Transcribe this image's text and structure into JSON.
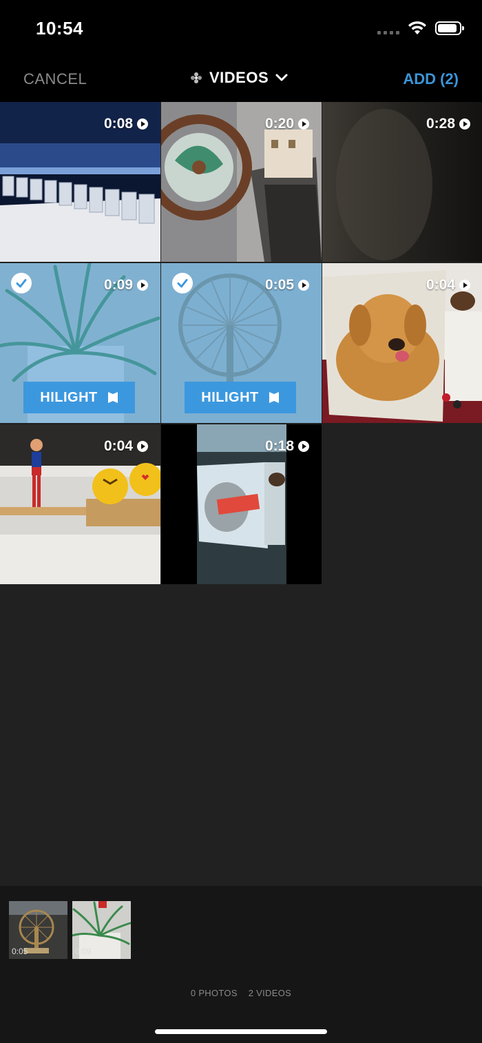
{
  "status_bar": {
    "time": "10:54",
    "battery_level": 0.9
  },
  "nav": {
    "cancel_label": "CANCEL",
    "title": "VIDEOS",
    "add_label": "ADD (2)",
    "accent_color": "#3b95d9"
  },
  "grid": {
    "tiles": [
      {
        "duration": "0:08",
        "selected": false,
        "scene": "shot glasses on bar counter"
      },
      {
        "duration": "0:20",
        "selected": false,
        "scene": "ship wheel souvenir magnet"
      },
      {
        "duration": "0:28",
        "selected": false,
        "scene": "dark blurred frame"
      },
      {
        "duration": "0:09",
        "selected": true,
        "scene": "potted spider plant"
      },
      {
        "duration": "0:05",
        "selected": true,
        "scene": "ferris wheel ornament"
      },
      {
        "duration": "0:04",
        "selected": false,
        "scene": "golden retriever picture"
      },
      {
        "duration": "0:04",
        "selected": false,
        "scene": "figurine and emoji toys on shelf"
      },
      {
        "duration": "0:18",
        "selected": false,
        "scene": "dog picture on screen"
      }
    ],
    "hilight_label": "HILIGHT",
    "selected_overlay_color": "#4ea0dc"
  },
  "tray": {
    "thumbs": [
      {
        "duration": "0:05"
      },
      {
        "duration": "0:09"
      }
    ],
    "photos_count": "0 PHOTOS",
    "videos_count": "2 VIDEOS"
  }
}
